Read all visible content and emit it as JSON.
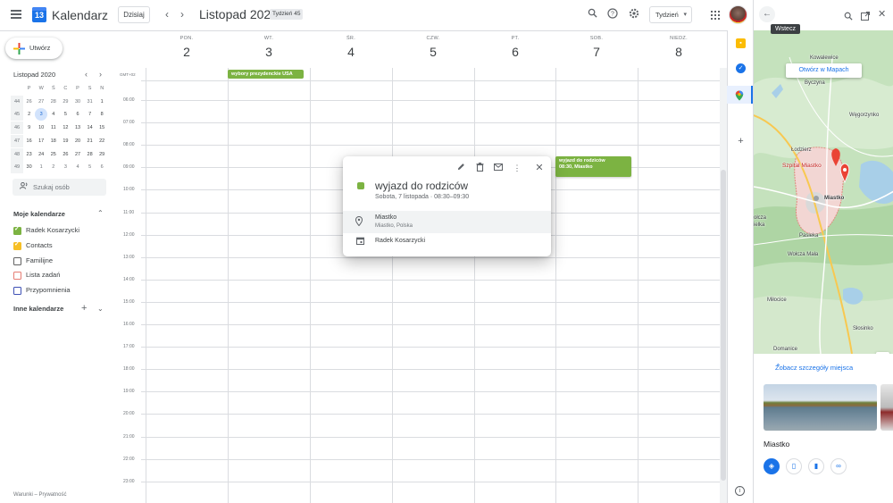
{
  "header": {
    "app_title": "Kalendarz",
    "logo_day": "13",
    "today_label": "Dzisiaj",
    "month_title": "Listopad 2020",
    "week_badge": "Tydzień 45",
    "view_label": "Tydzień"
  },
  "sidebar": {
    "create_label": "Utwórz",
    "mini_calendar": {
      "title": "Listopad 2020",
      "dow": [
        "P",
        "W",
        "Ś",
        "C",
        "P",
        "S",
        "N"
      ],
      "weeks": [
        {
          "wk": "44",
          "days": [
            "26",
            "27",
            "28",
            "29",
            "30",
            "31",
            "1"
          ],
          "other": [
            0,
            1,
            2,
            3,
            4,
            5
          ]
        },
        {
          "wk": "45",
          "days": [
            "2",
            "3",
            "4",
            "5",
            "6",
            "7",
            "8"
          ],
          "other": []
        },
        {
          "wk": "46",
          "days": [
            "9",
            "10",
            "11",
            "12",
            "13",
            "14",
            "15"
          ],
          "other": []
        },
        {
          "wk": "47",
          "days": [
            "16",
            "17",
            "18",
            "19",
            "20",
            "21",
            "22"
          ],
          "other": []
        },
        {
          "wk": "48",
          "days": [
            "23",
            "24",
            "25",
            "26",
            "27",
            "28",
            "29"
          ],
          "other": []
        },
        {
          "wk": "49",
          "days": [
            "30",
            "1",
            "2",
            "3",
            "4",
            "5",
            "6"
          ],
          "other": [
            1,
            2,
            3,
            4,
            5,
            6
          ]
        }
      ],
      "today": "3"
    },
    "search_people_placeholder": "Szukaj osób",
    "my_calendars_title": "Moje kalendarze",
    "my_calendars": [
      {
        "label": "Radek Kosarzycki",
        "color": "#7cb342",
        "checked": true
      },
      {
        "label": "Contacts",
        "color": "#f6bf26",
        "checked": true
      },
      {
        "label": "Familijne",
        "color": "#616161",
        "checked": false
      },
      {
        "label": "Lista zadań",
        "color": "#e67c73",
        "checked": false
      },
      {
        "label": "Przypomnienia",
        "color": "#3f51b5",
        "checked": false
      }
    ],
    "other_calendars_title": "Inne kalendarze",
    "footer": "Warunki – Prywatność"
  },
  "calendar": {
    "timezone": "GMT+02",
    "days": [
      {
        "name": "PON.",
        "num": "2"
      },
      {
        "name": "WT.",
        "num": "3"
      },
      {
        "name": "ŚR.",
        "num": "4"
      },
      {
        "name": "CZW.",
        "num": "5"
      },
      {
        "name": "PT.",
        "num": "6"
      },
      {
        "name": "SOB.",
        "num": "7"
      },
      {
        "name": "NIEDZ.",
        "num": "8"
      }
    ],
    "hours": [
      "06:00",
      "07:00",
      "08:00",
      "09:00",
      "10:00",
      "11:00",
      "12:00",
      "13:00",
      "14:00",
      "15:00",
      "16:00",
      "17:00",
      "18:00",
      "19:00",
      "20:00",
      "21:00",
      "22:00",
      "23:00"
    ],
    "allday_event": "wybory prezydenckie USA",
    "timed_event": {
      "title": "wyjazd do rodziców",
      "subtitle": "08:30, Miastko"
    }
  },
  "popup": {
    "title": "wyjazd do rodziców",
    "date": "Sobota, 7 listopada  ·  08:30–09:30",
    "location_main": "Miastko",
    "location_sub": "Miastko, Polska",
    "calendar_name": "Radek Kosarzycki",
    "color": "#7cb342"
  },
  "maps": {
    "tooltip": "Wstecz",
    "open_label": "Otwórz w Mapach",
    "labels": [
      "Kowalewice",
      "Byczyna",
      "Węgorzynko",
      "Łodzierz",
      "Szpital Miastko",
      "Miastko",
      "Pasieka",
      "Wołcza Mała",
      "Miłocice",
      "Słosinko",
      "Domanice",
      "ołcza",
      "ielka"
    ],
    "details_link": "Zobacz szczegóły miejsca",
    "place_name": "Miastko"
  }
}
